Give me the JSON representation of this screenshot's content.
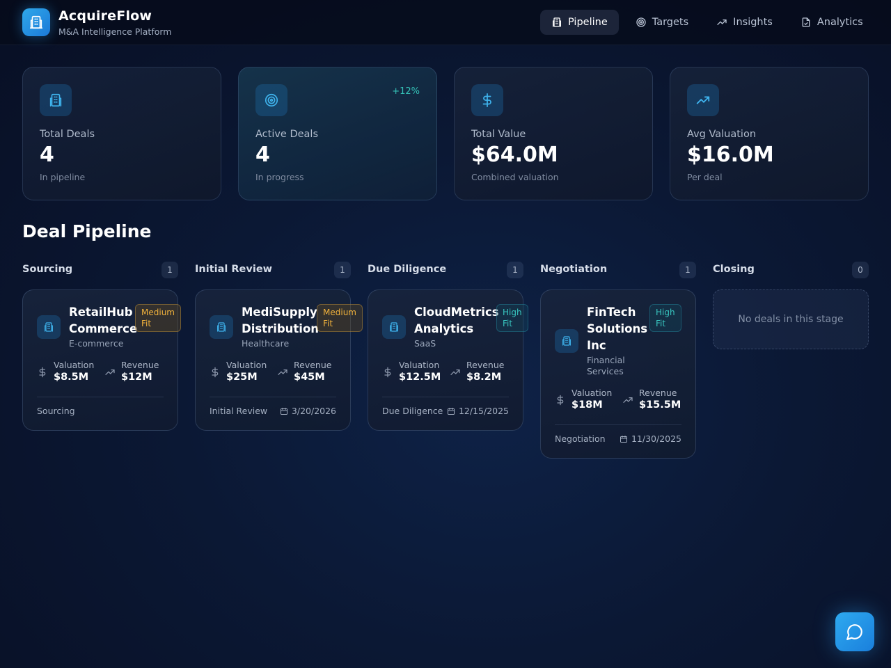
{
  "brand": {
    "title": "AcquireFlow",
    "subtitle": "M&A Intelligence Platform",
    "icon": "building-icon"
  },
  "nav": [
    {
      "label": "Pipeline",
      "icon": "building-icon",
      "active": true
    },
    {
      "label": "Targets",
      "icon": "target-icon",
      "active": false
    },
    {
      "label": "Insights",
      "icon": "trending-up-icon",
      "active": false
    },
    {
      "label": "Analytics",
      "icon": "file-chart-icon",
      "active": false
    }
  ],
  "stats": [
    {
      "label": "Total Deals",
      "value": "4",
      "note": "In pipeline",
      "icon": "building-icon"
    },
    {
      "label": "Active Deals",
      "value": "4",
      "note": "In progress",
      "icon": "target-icon",
      "trend": "+12%"
    },
    {
      "label": "Total Value",
      "value": "$64.0M",
      "note": "Combined valuation",
      "icon": "dollar-icon"
    },
    {
      "label": "Avg Valuation",
      "value": "$16.0M",
      "note": "Per deal",
      "icon": "trending-up-icon"
    }
  ],
  "pipeline": {
    "title": "Deal Pipeline",
    "columns": [
      {
        "name": "Sourcing",
        "count": "1"
      },
      {
        "name": "Initial Review",
        "count": "1"
      },
      {
        "name": "Due Diligence",
        "count": "1"
      },
      {
        "name": "Negotiation",
        "count": "1"
      },
      {
        "name": "Closing",
        "count": "0"
      }
    ],
    "empty_text": "No deals in this stage",
    "metric_labels": {
      "valuation": "Valuation",
      "revenue": "Revenue"
    },
    "deals": [
      {
        "company_line1": "RetailHub",
        "company_line2": "Commerce",
        "industry": "E-commerce",
        "fit_line1": "Medium",
        "fit_line2": "Fit",
        "fit_level": "medium",
        "valuation": "$8.5M",
        "revenue": "$12M",
        "stage": "Sourcing",
        "date": ""
      },
      {
        "company_line1": "MediSupply",
        "company_line2": "Distribution",
        "industry": "Healthcare",
        "fit_line1": "Medium",
        "fit_line2": "Fit",
        "fit_level": "medium",
        "valuation": "$25M",
        "revenue": "$45M",
        "stage": "Initial Review",
        "date": "3/20/2026"
      },
      {
        "company_line1": "CloudMetrics",
        "company_line2": "Analytics",
        "industry": "SaaS",
        "fit_line1": "High",
        "fit_line2": "Fit",
        "fit_level": "high",
        "valuation": "$12.5M",
        "revenue": "$8.2M",
        "stage": "Due Diligence",
        "date": "12/15/2025"
      },
      {
        "company_line1": "FinTech",
        "company_line2": "Solutions",
        "company_line3": "Inc",
        "industry_line1": "Financial",
        "industry_line2": "Services",
        "fit_line1": "High",
        "fit_line2": "Fit",
        "fit_level": "high",
        "valuation": "$18M",
        "revenue": "$15.5M",
        "stage": "Negotiation",
        "date": "11/30/2025"
      }
    ]
  },
  "colors": {
    "accent": "#2fa8ea",
    "positive": "#35c3b8",
    "medium_fit": "#f0b13c",
    "high_fit": "#38c6c0"
  },
  "chat": {
    "icon": "chat-bubble-icon"
  }
}
